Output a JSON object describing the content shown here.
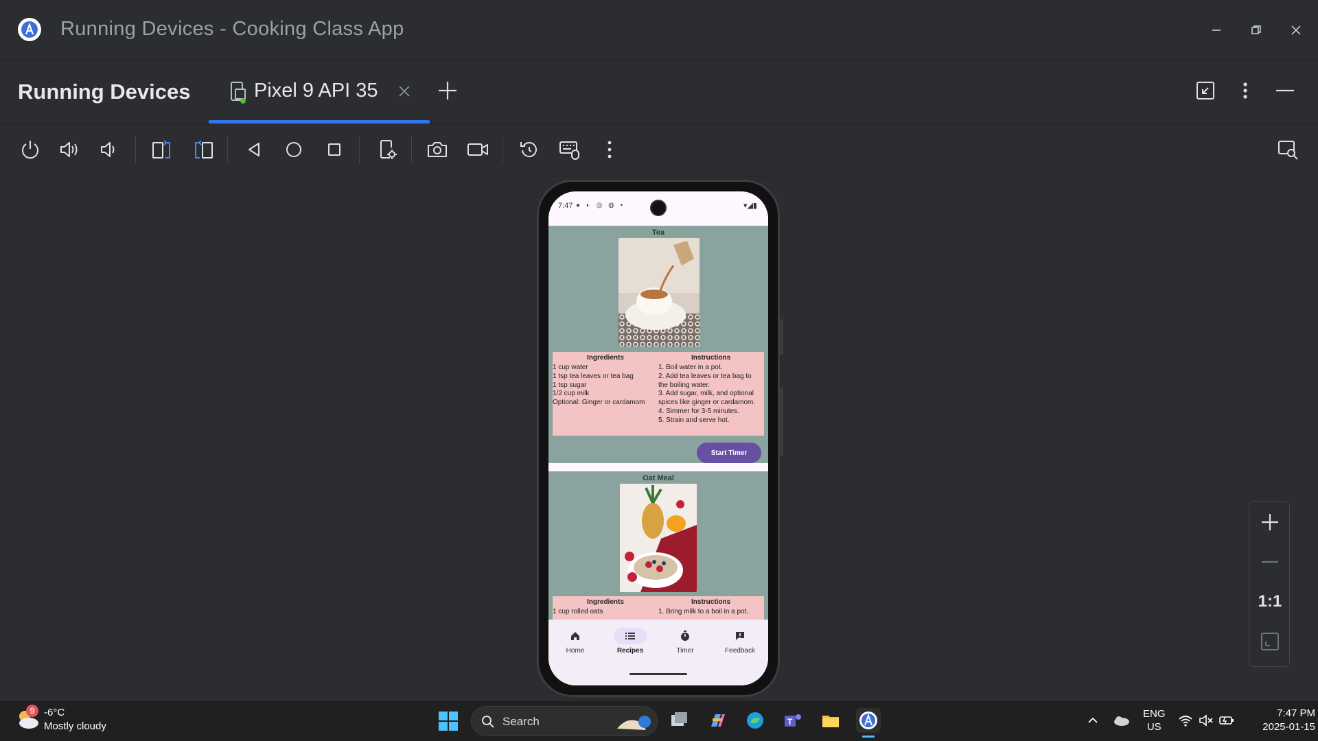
{
  "window": {
    "title": "Running Devices - Cooking Class App"
  },
  "panel": {
    "title": "Running Devices",
    "device_tab_label": "Pixel 9 API 35"
  },
  "toolbar": {
    "buttons": [
      "power-icon",
      "volume-up-icon",
      "volume-down-icon",
      "rotate-left-icon",
      "rotate-right-icon",
      "back-icon",
      "home-icon",
      "overview-icon",
      "device-settings-icon",
      "screenshot-icon",
      "screen-record-icon",
      "reset-icon",
      "keyboard-mouse-icon",
      "more-vert-icon"
    ]
  },
  "phone": {
    "status": {
      "time": "7:47",
      "left_icons": "● ◐ ◎ ◍ •",
      "right_icons": "▾◢▮"
    },
    "recipes": [
      {
        "title": "Tea",
        "ingredients_header": "Ingredients",
        "instructions_header": "Instructions",
        "ingredients": "1 cup water\n1 tsp tea leaves or tea bag\n1 tsp sugar\n1/2 cup milk\nOptional: Ginger or cardamom",
        "instructions": "1. Boil water in a pot.\n2. Add tea leaves or tea bag to the boiling water.\n3. Add sugar, milk, and optional spices like ginger or cardamom.\n4. Simmer for 3-5 minutes.\n5. Strain and serve hot.",
        "button": "Start Timer"
      },
      {
        "title": "Oat Meal",
        "ingredients_header": "Ingredients",
        "instructions_header": "Instructions",
        "ingredients": "1 cup rolled oats",
        "instructions": "1. Bring milk to a boil in a pot."
      }
    ],
    "nav": [
      {
        "label": "Home",
        "icon": "home-icon",
        "active": false
      },
      {
        "label": "Recipes",
        "icon": "list-icon",
        "active": true
      },
      {
        "label": "Timer",
        "icon": "timer-icon",
        "active": false
      },
      {
        "label": "Feedback",
        "icon": "feedback-icon",
        "active": false
      }
    ]
  },
  "zoom": {
    "in": "+",
    "out": "—",
    "actual": "1:1"
  },
  "taskbar": {
    "weather_badge": "9",
    "weather_temp": "-6°C",
    "weather_desc": "Mostly cloudy",
    "search_label": "Search",
    "lang_top": "ENG",
    "lang_bottom": "US",
    "time": "7:47 PM",
    "date": "2025-01-15"
  },
  "colors": {
    "accent": "#3574f0",
    "card_bg": "#8aa39e",
    "table_bg": "#f4c3c3",
    "button_bg": "#6750a4"
  }
}
